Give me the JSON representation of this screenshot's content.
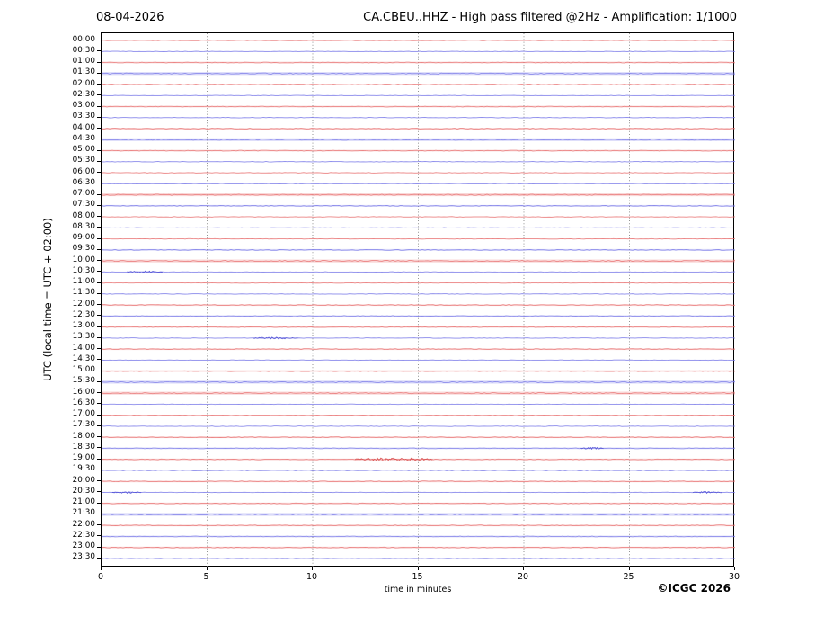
{
  "page": {
    "date_label": "08-04-2026",
    "title": "CA.CBEU..HHZ - High pass filtered @2Hz - Amplification: 1/1000",
    "copyright": "©ICGC 2026"
  },
  "chart_data": {
    "type": "line",
    "variant": "helicorder-drum-plot",
    "date": "08-04-2026",
    "station": "CA.CBEU..HHZ",
    "processing": "High pass filtered @2Hz",
    "amplification": "1/1000",
    "xlabel": "time in minutes",
    "ylabel": "UTC (local time = UTC + 02:00)",
    "xlim": [
      0,
      30
    ],
    "x_ticks": [
      0,
      5,
      10,
      15,
      20,
      25,
      30
    ],
    "minutes_per_row": 30,
    "grid": "vertical dotted gridlines every 5 minutes",
    "legend": "none",
    "colors": {
      "hour_trace": "#e87272",
      "half_hour_trace": "#7b7be8",
      "hour_event": "#d84f4f",
      "half_hour_event": "#5353d6",
      "grid": "#777777",
      "frame": "#000000"
    },
    "rows": [
      {
        "label": "00:00",
        "noise": 1
      },
      {
        "label": "00:30",
        "noise": 1
      },
      {
        "label": "01:00",
        "noise": 2
      },
      {
        "label": "01:30",
        "noise": 3
      },
      {
        "label": "02:00",
        "noise": 2
      },
      {
        "label": "02:30",
        "noise": 1
      },
      {
        "label": "03:00",
        "noise": 2
      },
      {
        "label": "03:30",
        "noise": 1
      },
      {
        "label": "04:00",
        "noise": 2
      },
      {
        "label": "04:30",
        "noise": 3
      },
      {
        "label": "05:00",
        "noise": 2
      },
      {
        "label": "05:30",
        "noise": 1
      },
      {
        "label": "06:00",
        "noise": 1
      },
      {
        "label": "06:30",
        "noise": 1
      },
      {
        "label": "07:00",
        "noise": 3
      },
      {
        "label": "07:30",
        "noise": 2
      },
      {
        "label": "08:00",
        "noise": 1
      },
      {
        "label": "08:30",
        "noise": 1
      },
      {
        "label": "09:00",
        "noise": 1
      },
      {
        "label": "09:30",
        "noise": 2
      },
      {
        "label": "10:00",
        "noise": 3
      },
      {
        "label": "10:30",
        "noise": 1
      },
      {
        "label": "11:00",
        "noise": 1
      },
      {
        "label": "11:30",
        "noise": 1
      },
      {
        "label": "12:00",
        "noise": 2
      },
      {
        "label": "12:30",
        "noise": 2
      },
      {
        "label": "13:00",
        "noise": 2
      },
      {
        "label": "13:30",
        "noise": 1
      },
      {
        "label": "14:00",
        "noise": 2
      },
      {
        "label": "14:30",
        "noise": 1
      },
      {
        "label": "15:00",
        "noise": 2
      },
      {
        "label": "15:30",
        "noise": 3
      },
      {
        "label": "16:00",
        "noise": 3
      },
      {
        "label": "16:30",
        "noise": 1
      },
      {
        "label": "17:00",
        "noise": 1
      },
      {
        "label": "17:30",
        "noise": 1
      },
      {
        "label": "18:00",
        "noise": 2
      },
      {
        "label": "18:30",
        "noise": 2
      },
      {
        "label": "19:00",
        "noise": 2
      },
      {
        "label": "19:30",
        "noise": 2
      },
      {
        "label": "20:00",
        "noise": 2
      },
      {
        "label": "20:30",
        "noise": 1
      },
      {
        "label": "21:00",
        "noise": 2
      },
      {
        "label": "21:30",
        "noise": 3
      },
      {
        "label": "22:00",
        "noise": 2
      },
      {
        "label": "22:30",
        "noise": 2
      },
      {
        "label": "23:00",
        "noise": 2
      },
      {
        "label": "23:30",
        "noise": 1
      }
    ],
    "events": [
      {
        "row": "10:30",
        "start_min": 1.2,
        "end_min": 2.9,
        "amplitude": "small"
      },
      {
        "row": "13:30",
        "start_min": 7.2,
        "end_min": 9.3,
        "amplitude": "small"
      },
      {
        "row": "18:30",
        "start_min": 22.7,
        "end_min": 23.8,
        "amplitude": "small"
      },
      {
        "row": "19:00",
        "start_min": 12.0,
        "end_min": 15.7,
        "amplitude": "moderate"
      },
      {
        "row": "20:30",
        "start_min": 0.5,
        "end_min": 1.9,
        "amplitude": "small"
      },
      {
        "row": "20:30",
        "start_min": 28.0,
        "end_min": 29.4,
        "amplitude": "small"
      }
    ]
  }
}
